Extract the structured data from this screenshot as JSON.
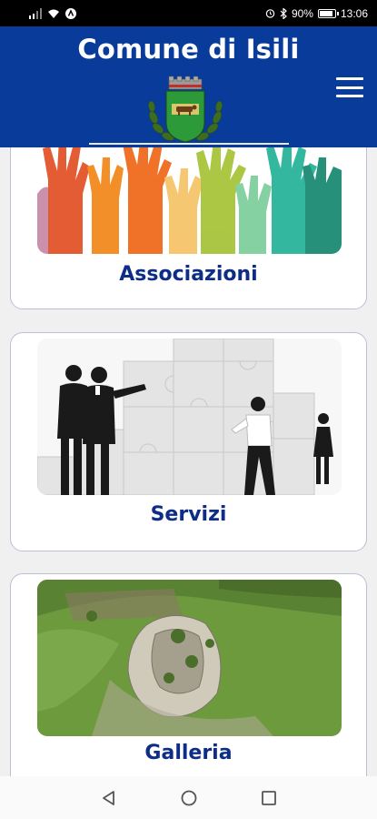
{
  "status_bar": {
    "battery": "90%",
    "battery_level": 0.9,
    "time": "13:06"
  },
  "header": {
    "title": "Comune di Isili"
  },
  "cards": [
    {
      "label": "Associazioni",
      "image": "raised-colorful-hands"
    },
    {
      "label": "Servizi",
      "image": "business-people-puzzle"
    },
    {
      "label": "Galleria",
      "image": "nuraghe-aerial-view"
    }
  ],
  "nav": {
    "back": "back-icon",
    "home": "home-icon",
    "recents": "recents-icon"
  },
  "colors": {
    "header_bg": "#083b9a",
    "label": "#0d2d86",
    "card_border": "#b8c2d3"
  }
}
